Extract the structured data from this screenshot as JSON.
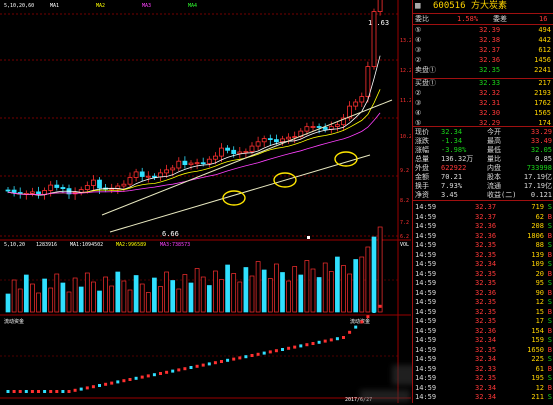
{
  "stock": {
    "code": "600516",
    "name": "方大炭素"
  },
  "chart": {
    "top_indicators": [
      "5,10,20,60",
      "MA1  ",
      "MA2  ",
      "MA3  ",
      "MA4  "
    ],
    "high_label": "13.63",
    "low_label": "6.66",
    "price_ticks": [
      "13.2",
      "12.2",
      "11.2",
      "10.2",
      "9.2",
      "8.2",
      "7.2",
      "6.2"
    ],
    "vol_header": [
      "5,10,20",
      "1283916",
      "MA1:1094502",
      "MA2:996589",
      "MA3:738573"
    ],
    "vol_right": "VOL",
    "fund_label_left": "流动资金",
    "fund_label_right": "流动资金",
    "date_label": "2017/6/27"
  },
  "order_book": {
    "ratio_label": "委比",
    "ratio_value": "1.58%",
    "diff_label": "委差",
    "diff_value": "16",
    "sell": [
      {
        "label": "⑤",
        "price": "32.39",
        "vol": "494"
      },
      {
        "label": "④",
        "price": "32.38",
        "vol": "442"
      },
      {
        "label": "③",
        "price": "32.37",
        "vol": "612"
      },
      {
        "label": "②",
        "price": "32.36",
        "vol": "1456"
      },
      {
        "label": "卖盘①",
        "price": "32.35",
        "vol": "2241"
      }
    ],
    "buy": [
      {
        "label": "买盘①",
        "price": "32.33",
        "vol": "217"
      },
      {
        "label": "②",
        "price": "32.32",
        "vol": "2193"
      },
      {
        "label": "③",
        "price": "32.31",
        "vol": "1762"
      },
      {
        "label": "④",
        "price": "32.30",
        "vol": "1565"
      },
      {
        "label": "⑤",
        "price": "32.29",
        "vol": "174"
      }
    ]
  },
  "quote": [
    {
      "l1": "现价",
      "v1": "32.34",
      "l2": "今开",
      "v2": "33.29",
      "c1": "green",
      "c2": "red"
    },
    {
      "l1": "涨跌",
      "v1": "-1.34",
      "l2": "最高",
      "v2": "33.49",
      "c1": "green",
      "c2": "red"
    },
    {
      "l1": "涨幅",
      "v1": "-3.98%",
      "l2": "最低",
      "v2": "32.05",
      "c1": "green",
      "c2": "green"
    },
    {
      "l1": "总量",
      "v1": "136.32万",
      "l2": "量比",
      "v2": "0.85",
      "c1": "white",
      "c2": "white"
    },
    {
      "l1": "外盘",
      "v1": "622922",
      "l2": "内盘",
      "v2": "733998",
      "c1": "red",
      "c2": "green"
    },
    {
      "l1": "金额",
      "v1": "70.21",
      "l2": "股本",
      "v2": "17.19亿",
      "c1": "white",
      "c2": "white"
    },
    {
      "l1": "换手",
      "v1": "7.93%",
      "l2": "流通",
      "v2": "17.19亿",
      "c1": "white",
      "c2": "white"
    },
    {
      "l1": "净资",
      "v1": "3.45",
      "l2": "收益(二)",
      "v2": "0.121",
      "c1": "white",
      "c2": "white"
    }
  ],
  "ticks": [
    {
      "t": "14:59",
      "p": "32.37",
      "v": "719",
      "d": "S"
    },
    {
      "t": "14:59",
      "p": "32.37",
      "v": "62",
      "d": "B"
    },
    {
      "t": "14:59",
      "p": "32.36",
      "v": "208",
      "d": "S"
    },
    {
      "t": "14:59",
      "p": "32.36",
      "v": "1806",
      "d": "B"
    },
    {
      "t": "14:59",
      "p": "32.35",
      "v": "88",
      "d": "S"
    },
    {
      "t": "14:59",
      "p": "32.35",
      "v": "139",
      "d": "B"
    },
    {
      "t": "14:59",
      "p": "32.34",
      "v": "109",
      "d": "S"
    },
    {
      "t": "14:59",
      "p": "32.35",
      "v": "20",
      "d": "B"
    },
    {
      "t": "14:59",
      "p": "32.35",
      "v": "95",
      "d": "S"
    },
    {
      "t": "14:59",
      "p": "32.36",
      "v": "90",
      "d": "B"
    },
    {
      "t": "14:59",
      "p": "32.35",
      "v": "12",
      "d": "S"
    },
    {
      "t": "14:59",
      "p": "32.35",
      "v": "15",
      "d": "B"
    },
    {
      "t": "14:59",
      "p": "32.35",
      "v": "17",
      "d": "S"
    },
    {
      "t": "14:59",
      "p": "32.36",
      "v": "154",
      "d": "B"
    },
    {
      "t": "14:59",
      "p": "32.34",
      "v": "159",
      "d": "S"
    },
    {
      "t": "14:59",
      "p": "32.35",
      "v": "1650",
      "d": "B"
    },
    {
      "t": "14:59",
      "p": "32.34",
      "v": "225",
      "d": "S"
    },
    {
      "t": "14:59",
      "p": "32.33",
      "v": "61",
      "d": "B"
    },
    {
      "t": "14:59",
      "p": "32.35",
      "v": "195",
      "d": "S"
    },
    {
      "t": "14:59",
      "p": "32.34",
      "v": "12",
      "d": "B"
    },
    {
      "t": "14:59",
      "p": "32.34",
      "v": "211",
      "d": "S"
    }
  ],
  "colors": {
    "up": "#ff3030",
    "down": "#30e0ff",
    "grid": "#9a0000",
    "ma": "#ffd400",
    "channel": "#e8e8c0"
  }
}
